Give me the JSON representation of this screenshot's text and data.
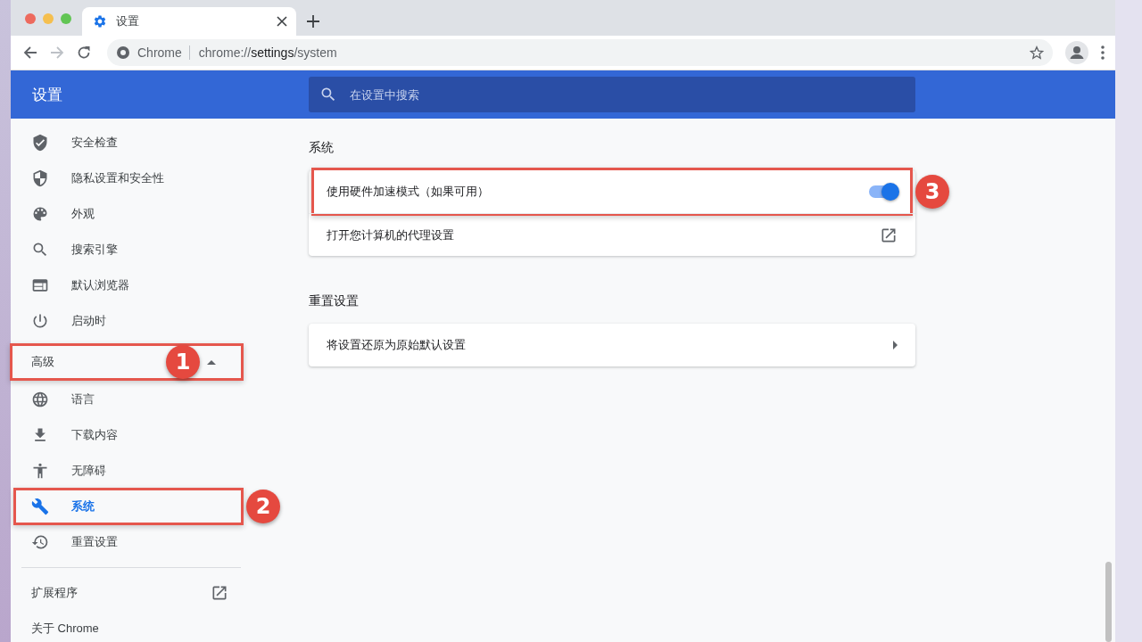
{
  "browser": {
    "tab": {
      "title": "设置",
      "selected": true
    },
    "site_chip": "Chrome",
    "url": "chrome://**settings**/system"
  },
  "header": {
    "title": "设置",
    "search_placeholder": "在设置中搜索"
  },
  "sidebar": {
    "items": [
      {
        "label": "安全检查",
        "selected": false
      },
      {
        "label": "隐私设置和安全性",
        "selected": false
      },
      {
        "label": "外观",
        "selected": false
      },
      {
        "label": "搜索引擎",
        "selected": false
      },
      {
        "label": "默认浏览器",
        "selected": false
      },
      {
        "label": "启动时",
        "selected": false
      }
    ],
    "advanced": {
      "label": "高级",
      "expanded": true,
      "callout": "1"
    },
    "advanced_items": [
      {
        "label": "语言",
        "selected": false
      },
      {
        "label": "下载内容",
        "selected": false
      },
      {
        "label": "无障碍",
        "selected": false
      },
      {
        "label": "系统",
        "selected": true,
        "callout": "2"
      },
      {
        "label": "重置设置",
        "selected": false
      }
    ],
    "extensions": "扩展程序",
    "about": "关于 Chrome"
  },
  "sections": [
    {
      "title": "系统",
      "rows": [
        {
          "kind": "toggle",
          "label": "使用硬件加速模式（如果可用）",
          "on": true,
          "callout": "3"
        },
        {
          "kind": "external",
          "label": "打开您计算机的代理设置"
        }
      ]
    },
    {
      "title": "重置设置",
      "rows": [
        {
          "kind": "arrow",
          "label": "将设置还原为原始默认设置"
        }
      ]
    }
  ]
}
